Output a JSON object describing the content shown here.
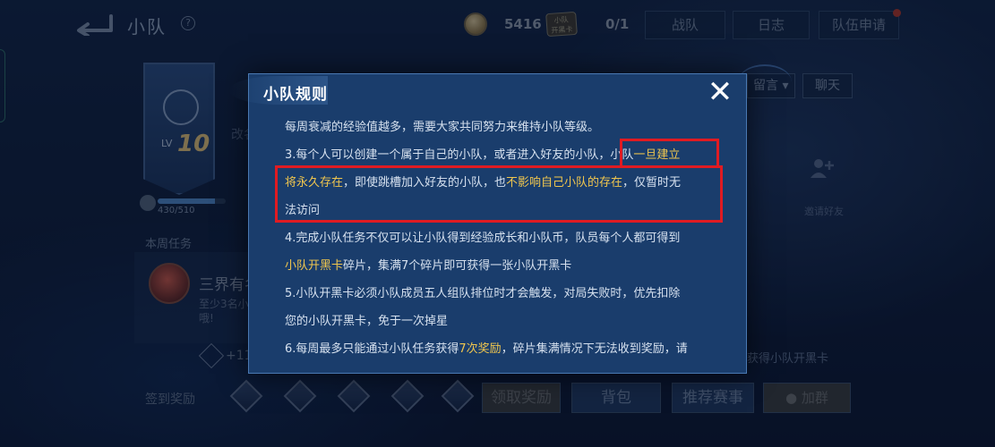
{
  "topbar": {
    "title": "小队",
    "help": "?",
    "coins": "5416",
    "ticket_label": "小队\n开黑卡",
    "ticket_count": "0/1",
    "tabs": [
      {
        "label": "战队"
      },
      {
        "label": "日志"
      },
      {
        "label": "队伍申请"
      }
    ]
  },
  "team": {
    "level_prefix": "LV",
    "level": "10",
    "exp_text": "430/510",
    "exp_progress": 0.843,
    "rename_hint": "改名"
  },
  "weekly": {
    "label": "本周任务",
    "task_name": "三界有名",
    "task_desc": "至少3名小\n哦!",
    "reward_plus": "+11"
  },
  "right_panel": {
    "message_select": "留言",
    "chat_button": "聊天",
    "invite_label": "邀请好友",
    "reward_text": "获得小队开黑卡"
  },
  "bottom": {
    "signin_label": "签到奖励",
    "claim_button": "领取奖励",
    "bag_button": "背包",
    "recommend_button": "推荐赛事",
    "join_button": "加群"
  },
  "modal": {
    "title": "小队规则",
    "close": "✕",
    "lines": [
      [
        {
          "text": "每周衰减的经验值越多，需要大家共同努力来维持小队等级。"
        }
      ],
      [
        {
          "text": "3.每个人可以创建一个属于自己的小队，或者进入好友的小队，"
        },
        {
          "text": "小队"
        },
        {
          "text": "一旦建立",
          "hl": true
        }
      ],
      [
        {
          "text": "将永久存在",
          "hl": true
        },
        {
          "text": "，即使跳槽加入好友的小队，也"
        },
        {
          "text": "不影响自己小队的存在",
          "hl": true
        },
        {
          "text": "，仅暂时无"
        }
      ],
      [
        {
          "text": "法访问"
        }
      ],
      [
        {
          "text": "4.完成小队任务不仅可以让小队得到经验成长和小队币，队员每个人都可得到"
        }
      ],
      [
        {
          "text": "小队开黑卡",
          "hl": true
        },
        {
          "text": "碎片，集满7个碎片即可获得一张小队开黑卡"
        }
      ],
      [
        {
          "text": "5.小队开黑卡必须小队成员五人组队排位时才会触发，对局失败时，优先扣除"
        }
      ],
      [
        {
          "text": "您的小队开黑卡，免于一次掉星"
        }
      ],
      [
        {
          "text": "6.每周最多只能通过小队任务获得"
        },
        {
          "text": "7次奖励",
          "hl": true
        },
        {
          "text": "，碎片集满情况下无法收到奖励，请"
        }
      ]
    ]
  },
  "colors": {
    "highlight": "#f0c64e",
    "annotation_box": "#e01b22",
    "modal_bg": "#1a3d6c"
  }
}
